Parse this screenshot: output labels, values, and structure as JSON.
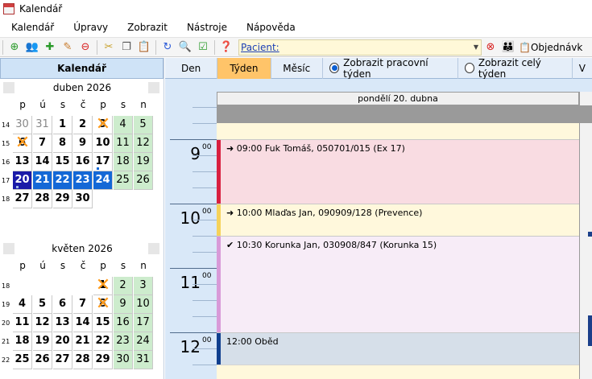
{
  "window": {
    "title": "Kalendář"
  },
  "menu": [
    "Kalendář",
    "Úpravy",
    "Zobrazit",
    "Nástroje",
    "Nápověda"
  ],
  "toolbar": {
    "patient_label": "Pacient:",
    "patient_value": "",
    "order_label": "Objednávk"
  },
  "left_panel": {
    "header": "Kalendář",
    "weekday_headers": [
      "p",
      "ú",
      "s",
      "č",
      "p",
      "s",
      "n"
    ],
    "months": [
      {
        "title": "duben 2026",
        "weeks": [
          {
            "num": "14",
            "days": [
              "30",
              "31",
              "1",
              "2",
              "3",
              "4",
              "5"
            ]
          },
          {
            "num": "15",
            "days": [
              "6",
              "7",
              "8",
              "9",
              "10",
              "11",
              "12"
            ]
          },
          {
            "num": "16",
            "days": [
              "13",
              "14",
              "15",
              "16",
              "17",
              "18",
              "19"
            ]
          },
          {
            "num": "17",
            "days": [
              "20",
              "21",
              "22",
              "23",
              "24",
              "25",
              "26"
            ]
          },
          {
            "num": "18",
            "days": [
              "27",
              "28",
              "29",
              "30",
              "",
              "",
              ""
            ]
          }
        ]
      },
      {
        "title": "květen 2026",
        "weeks": [
          {
            "num": "18",
            "days": [
              "",
              "",
              "",
              "",
              "1",
              "2",
              "3"
            ]
          },
          {
            "num": "19",
            "days": [
              "4",
              "5",
              "6",
              "7",
              "8",
              "9",
              "10"
            ]
          },
          {
            "num": "20",
            "days": [
              "11",
              "12",
              "13",
              "14",
              "15",
              "16",
              "17"
            ]
          },
          {
            "num": "21",
            "days": [
              "18",
              "19",
              "20",
              "21",
              "22",
              "23",
              "24"
            ]
          },
          {
            "num": "22",
            "days": [
              "25",
              "26",
              "27",
              "28",
              "29",
              "30",
              "31"
            ]
          }
        ]
      }
    ]
  },
  "view_bar": {
    "tabs": [
      "Den",
      "Týden",
      "Měsíc"
    ],
    "active_tab": "Týden",
    "radio_work_week": "Zobrazit pracovní týden",
    "radio_full_week": "Zobrazit celý týden",
    "more": "V"
  },
  "day_view": {
    "day_header": "pondělí 20. dubna",
    "hours": [
      {
        "hour": "9",
        "min": "00"
      },
      {
        "hour": "10",
        "min": "00"
      },
      {
        "hour": "11",
        "min": "00"
      },
      {
        "hour": "12",
        "min": "00"
      }
    ],
    "appointments": [
      {
        "time": "09:00",
        "text": "➜ 09:00 Fuk Tomáš, 050701/015 (Ex 17)",
        "color": "#d82040",
        "bg": "#f9dce2"
      },
      {
        "time": "10:00",
        "text": "➜ 10:00 Mlaďas Jan, 090909/128 (Prevence)",
        "color": "#f5d25a",
        "bg": "#fff8dc"
      },
      {
        "time": "10:30",
        "text": "✔ 10:30 Korunka Jan, 030908/847 (Korunka 15)",
        "color": "#d89ad8",
        "bg": "#f7ecf7"
      },
      {
        "time": "12:00",
        "text": "12:00 Oběd",
        "color": "#0f3f8f",
        "bg": "#d6dfe9"
      }
    ]
  }
}
